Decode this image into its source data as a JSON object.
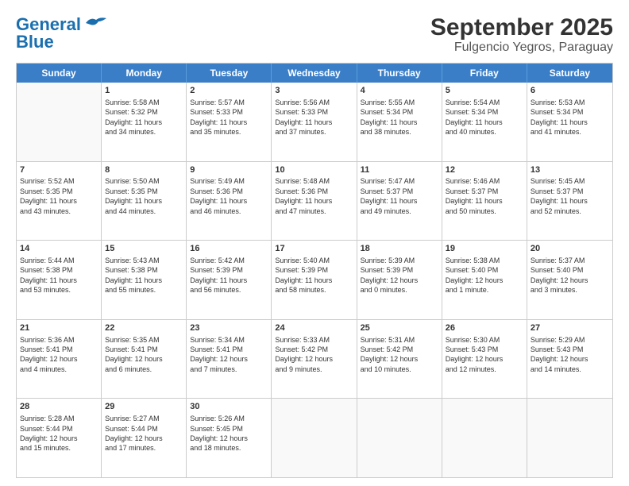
{
  "header": {
    "logo_line1": "General",
    "logo_line2": "Blue",
    "title": "September 2025",
    "subtitle": "Fulgencio Yegros, Paraguay"
  },
  "weekdays": [
    "Sunday",
    "Monday",
    "Tuesday",
    "Wednesday",
    "Thursday",
    "Friday",
    "Saturday"
  ],
  "rows": [
    [
      {
        "day": "",
        "text": ""
      },
      {
        "day": "1",
        "text": "Sunrise: 5:58 AM\nSunset: 5:32 PM\nDaylight: 11 hours\nand 34 minutes."
      },
      {
        "day": "2",
        "text": "Sunrise: 5:57 AM\nSunset: 5:33 PM\nDaylight: 11 hours\nand 35 minutes."
      },
      {
        "day": "3",
        "text": "Sunrise: 5:56 AM\nSunset: 5:33 PM\nDaylight: 11 hours\nand 37 minutes."
      },
      {
        "day": "4",
        "text": "Sunrise: 5:55 AM\nSunset: 5:34 PM\nDaylight: 11 hours\nand 38 minutes."
      },
      {
        "day": "5",
        "text": "Sunrise: 5:54 AM\nSunset: 5:34 PM\nDaylight: 11 hours\nand 40 minutes."
      },
      {
        "day": "6",
        "text": "Sunrise: 5:53 AM\nSunset: 5:34 PM\nDaylight: 11 hours\nand 41 minutes."
      }
    ],
    [
      {
        "day": "7",
        "text": "Sunrise: 5:52 AM\nSunset: 5:35 PM\nDaylight: 11 hours\nand 43 minutes."
      },
      {
        "day": "8",
        "text": "Sunrise: 5:50 AM\nSunset: 5:35 PM\nDaylight: 11 hours\nand 44 minutes."
      },
      {
        "day": "9",
        "text": "Sunrise: 5:49 AM\nSunset: 5:36 PM\nDaylight: 11 hours\nand 46 minutes."
      },
      {
        "day": "10",
        "text": "Sunrise: 5:48 AM\nSunset: 5:36 PM\nDaylight: 11 hours\nand 47 minutes."
      },
      {
        "day": "11",
        "text": "Sunrise: 5:47 AM\nSunset: 5:37 PM\nDaylight: 11 hours\nand 49 minutes."
      },
      {
        "day": "12",
        "text": "Sunrise: 5:46 AM\nSunset: 5:37 PM\nDaylight: 11 hours\nand 50 minutes."
      },
      {
        "day": "13",
        "text": "Sunrise: 5:45 AM\nSunset: 5:37 PM\nDaylight: 11 hours\nand 52 minutes."
      }
    ],
    [
      {
        "day": "14",
        "text": "Sunrise: 5:44 AM\nSunset: 5:38 PM\nDaylight: 11 hours\nand 53 minutes."
      },
      {
        "day": "15",
        "text": "Sunrise: 5:43 AM\nSunset: 5:38 PM\nDaylight: 11 hours\nand 55 minutes."
      },
      {
        "day": "16",
        "text": "Sunrise: 5:42 AM\nSunset: 5:39 PM\nDaylight: 11 hours\nand 56 minutes."
      },
      {
        "day": "17",
        "text": "Sunrise: 5:40 AM\nSunset: 5:39 PM\nDaylight: 11 hours\nand 58 minutes."
      },
      {
        "day": "18",
        "text": "Sunrise: 5:39 AM\nSunset: 5:39 PM\nDaylight: 12 hours\nand 0 minutes."
      },
      {
        "day": "19",
        "text": "Sunrise: 5:38 AM\nSunset: 5:40 PM\nDaylight: 12 hours\nand 1 minute."
      },
      {
        "day": "20",
        "text": "Sunrise: 5:37 AM\nSunset: 5:40 PM\nDaylight: 12 hours\nand 3 minutes."
      }
    ],
    [
      {
        "day": "21",
        "text": "Sunrise: 5:36 AM\nSunset: 5:41 PM\nDaylight: 12 hours\nand 4 minutes."
      },
      {
        "day": "22",
        "text": "Sunrise: 5:35 AM\nSunset: 5:41 PM\nDaylight: 12 hours\nand 6 minutes."
      },
      {
        "day": "23",
        "text": "Sunrise: 5:34 AM\nSunset: 5:41 PM\nDaylight: 12 hours\nand 7 minutes."
      },
      {
        "day": "24",
        "text": "Sunrise: 5:33 AM\nSunset: 5:42 PM\nDaylight: 12 hours\nand 9 minutes."
      },
      {
        "day": "25",
        "text": "Sunrise: 5:31 AM\nSunset: 5:42 PM\nDaylight: 12 hours\nand 10 minutes."
      },
      {
        "day": "26",
        "text": "Sunrise: 5:30 AM\nSunset: 5:43 PM\nDaylight: 12 hours\nand 12 minutes."
      },
      {
        "day": "27",
        "text": "Sunrise: 5:29 AM\nSunset: 5:43 PM\nDaylight: 12 hours\nand 14 minutes."
      }
    ],
    [
      {
        "day": "28",
        "text": "Sunrise: 5:28 AM\nSunset: 5:44 PM\nDaylight: 12 hours\nand 15 minutes."
      },
      {
        "day": "29",
        "text": "Sunrise: 5:27 AM\nSunset: 5:44 PM\nDaylight: 12 hours\nand 17 minutes."
      },
      {
        "day": "30",
        "text": "Sunrise: 5:26 AM\nSunset: 5:45 PM\nDaylight: 12 hours\nand 18 minutes."
      },
      {
        "day": "",
        "text": ""
      },
      {
        "day": "",
        "text": ""
      },
      {
        "day": "",
        "text": ""
      },
      {
        "day": "",
        "text": ""
      }
    ]
  ]
}
